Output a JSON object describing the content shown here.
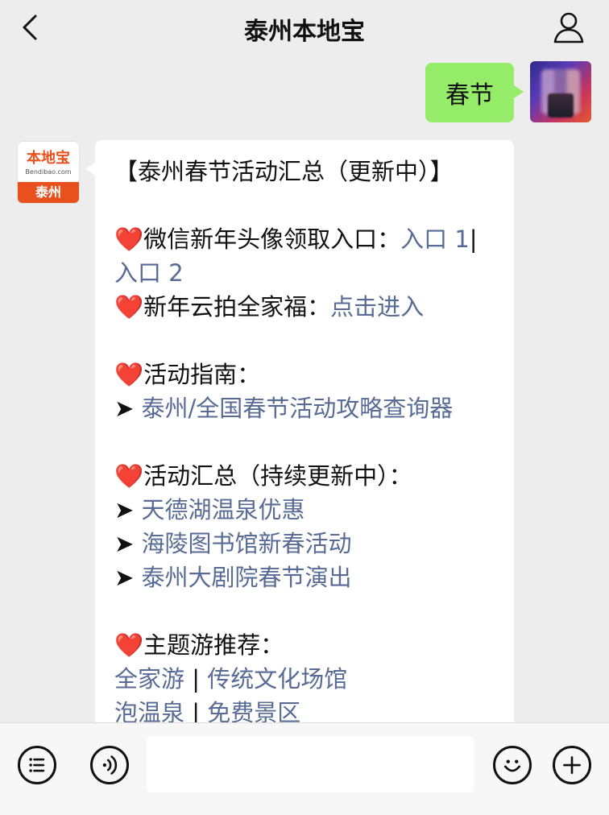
{
  "nav": {
    "title": "泰州本地宝",
    "back_icon": "chevron-left-icon",
    "profile_icon": "user-icon"
  },
  "outgoing": {
    "text": "春节",
    "avatar": "user-avatar-blurred"
  },
  "incoming": {
    "avatar": {
      "logo": "本地宝",
      "site": "Bendibao.com",
      "city": "泰州"
    },
    "title": "【泰州春节活动汇总（更新中）】",
    "heart": "❤️",
    "arrow": "➤",
    "section1": {
      "line1_label": "微信新年头像领取入口：",
      "line1_link": "入口 1",
      "sep": "|",
      "line1_link2": "入口 2",
      "line2_label": "新年云拍全家福：",
      "line2_link": "点击进入"
    },
    "section2": {
      "heading": "活动指南：",
      "items": [
        "泰州/全国春节活动攻略查询器"
      ]
    },
    "section3": {
      "heading": "活动汇总（持续更新中）：",
      "items": [
        "天德湖温泉优惠",
        "海陵图书馆新春活动",
        "泰州大剧院春节演出"
      ]
    },
    "section4": {
      "heading": "主题游推荐：",
      "row1": [
        "全家游",
        "传统文化场馆"
      ],
      "row2": [
        "泡温泉",
        "免费景区"
      ],
      "sep": " | "
    }
  },
  "bottom_bar": {
    "menu_icon": "menu-list-icon",
    "voice_icon": "voice-icon",
    "emoji_icon": "emoji-icon",
    "plus_icon": "plus-icon",
    "input_placeholder": ""
  },
  "colors": {
    "background": "#ededed",
    "outgoing_bubble": "#95ec69",
    "link": "#576b95",
    "brand": "#e8501d"
  }
}
